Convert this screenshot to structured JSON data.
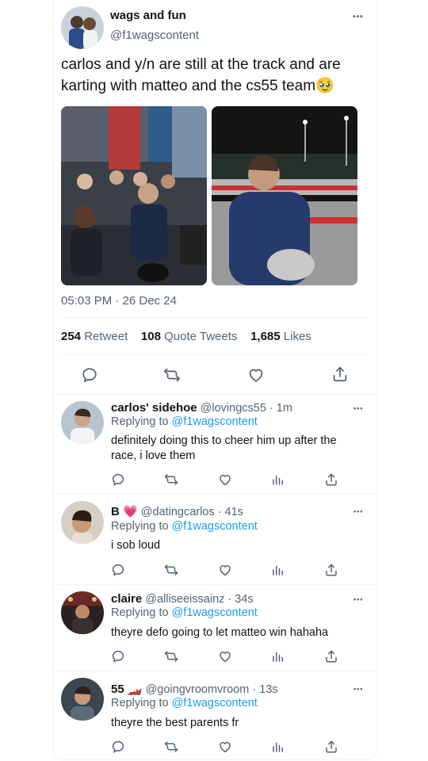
{
  "tweet": {
    "display_name": "wags and fun",
    "handle": "@f1wagscontent",
    "text": "carlos and y/n are still at the track and are karting with matteo and the cs55 team🥹",
    "timestamp": "05:03 PM · 26 Dec 24",
    "stats": {
      "retweets_count": "254",
      "retweets_label": "Retweet",
      "quotes_count": "108",
      "quotes_label": "Quote Tweets",
      "likes_count": "1,685",
      "likes_label": "Likes"
    },
    "actions": [
      "reply-icon",
      "retweet-icon",
      "like-icon",
      "share-icon"
    ]
  },
  "replies": [
    {
      "display_name": "carlos' sidehoe",
      "handle": "@lovingcs55",
      "time": "· 1m",
      "replying_label": "Replying to",
      "replying_to": "@f1wagscontent",
      "text": "definitely doing this to cheer him up after the race, i love them"
    },
    {
      "display_name": "B 💗",
      "handle": "@datingcarlos",
      "time": "· 41s",
      "replying_label": "Replying to",
      "replying_to": "@f1wagscontent",
      "text": "i sob loud"
    },
    {
      "display_name": "claire",
      "handle": "@alliseeissainz",
      "time": "· 34s",
      "replying_label": "Replying to",
      "replying_to": "@f1wagscontent",
      "text": "theyre defo going to let matteo win hahaha"
    },
    {
      "display_name": "55 🏎️",
      "handle": "@goingvroomvroom",
      "time": "· 13s",
      "replying_label": "Replying to",
      "replying_to": "@f1wagscontent",
      "text": "theyre the best parents fr"
    }
  ],
  "more_glyph": "•••",
  "colors": {
    "accent": "#1d9bf0",
    "muted": "#536471",
    "text": "#0f1419",
    "border": "#eff3f4"
  }
}
